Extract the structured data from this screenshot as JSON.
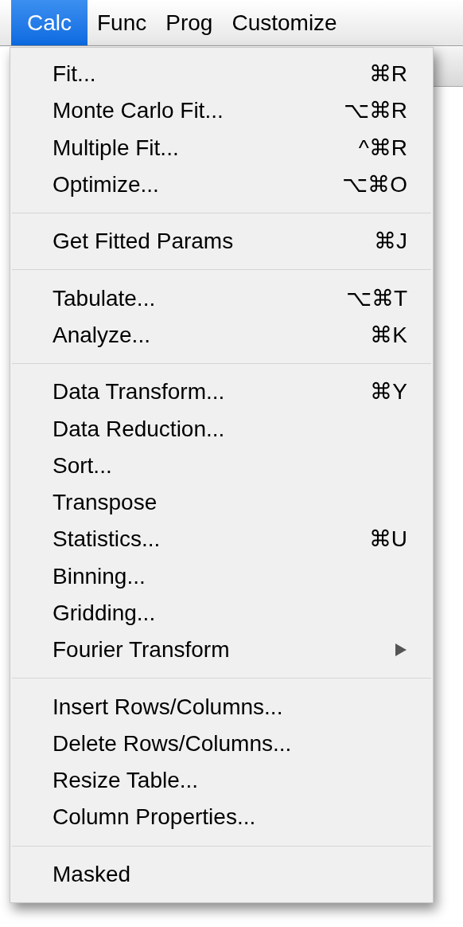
{
  "menu_bar": [
    {
      "label": "Calc",
      "selected": true
    },
    {
      "label": "Func",
      "selected": false
    },
    {
      "label": "Prog",
      "selected": false
    },
    {
      "label": "Customize",
      "selected": false
    }
  ],
  "menu": {
    "groups": [
      [
        {
          "label": "Fit...",
          "shortcut": "⌘R",
          "kind": "command"
        },
        {
          "label": "Monte Carlo Fit...",
          "shortcut": "⌥⌘R",
          "kind": "command"
        },
        {
          "label": "Multiple Fit...",
          "shortcut": "^⌘R",
          "kind": "command"
        },
        {
          "label": "Optimize...",
          "shortcut": "⌥⌘O",
          "kind": "command"
        }
      ],
      [
        {
          "label": "Get Fitted Params",
          "shortcut": "⌘J",
          "kind": "command"
        }
      ],
      [
        {
          "label": "Tabulate...",
          "shortcut": "⌥⌘T",
          "kind": "command"
        },
        {
          "label": "Analyze...",
          "shortcut": "⌘K",
          "kind": "command"
        }
      ],
      [
        {
          "label": "Data Transform...",
          "shortcut": "⌘Y",
          "kind": "command"
        },
        {
          "label": "Data Reduction...",
          "kind": "command"
        },
        {
          "label": "Sort...",
          "kind": "command"
        },
        {
          "label": "Transpose",
          "kind": "command"
        },
        {
          "label": "Statistics...",
          "shortcut": "⌘U",
          "kind": "command"
        },
        {
          "label": "Binning...",
          "kind": "command"
        },
        {
          "label": "Gridding...",
          "kind": "command"
        },
        {
          "label": "Fourier Transform",
          "kind": "submenu"
        }
      ],
      [
        {
          "label": "Insert Rows/Columns...",
          "kind": "command"
        },
        {
          "label": "Delete Rows/Columns...",
          "kind": "command"
        },
        {
          "label": "Resize Table...",
          "kind": "command"
        },
        {
          "label": "Column Properties...",
          "kind": "command"
        }
      ],
      [
        {
          "label": "Masked",
          "kind": "command"
        }
      ]
    ]
  }
}
